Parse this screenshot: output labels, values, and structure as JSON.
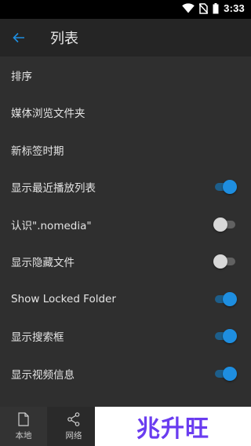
{
  "statusbar": {
    "time": "3:33",
    "icons": [
      "wifi-icon",
      "no-sim-icon",
      "battery-icon"
    ]
  },
  "appbar": {
    "title": "列表",
    "back_icon": "back-arrow-icon"
  },
  "settings": [
    {
      "label": "排序",
      "toggle": null
    },
    {
      "label": "媒体浏览文件夹",
      "toggle": null
    },
    {
      "label": "新标签时期",
      "toggle": null
    },
    {
      "label": "显示最近播放列表",
      "toggle": true
    },
    {
      "label": "认识\".nomedia\"",
      "toggle": false
    },
    {
      "label": "显示隐藏文件",
      "toggle": false
    },
    {
      "label": "Show Locked Folder",
      "toggle": true
    },
    {
      "label": "显示搜索框",
      "toggle": true
    },
    {
      "label": "显示视频信息",
      "toggle": true
    }
  ],
  "bottom_nav": {
    "tabs": [
      {
        "label": "本地",
        "icon": "file-icon"
      },
      {
        "label": "网络",
        "icon": "share-icon"
      }
    ]
  },
  "watermark": {
    "text": "兆升旺"
  },
  "colors": {
    "accent": "#1e8ee0",
    "background": "#2f2f2f",
    "appbar": "#252525"
  }
}
